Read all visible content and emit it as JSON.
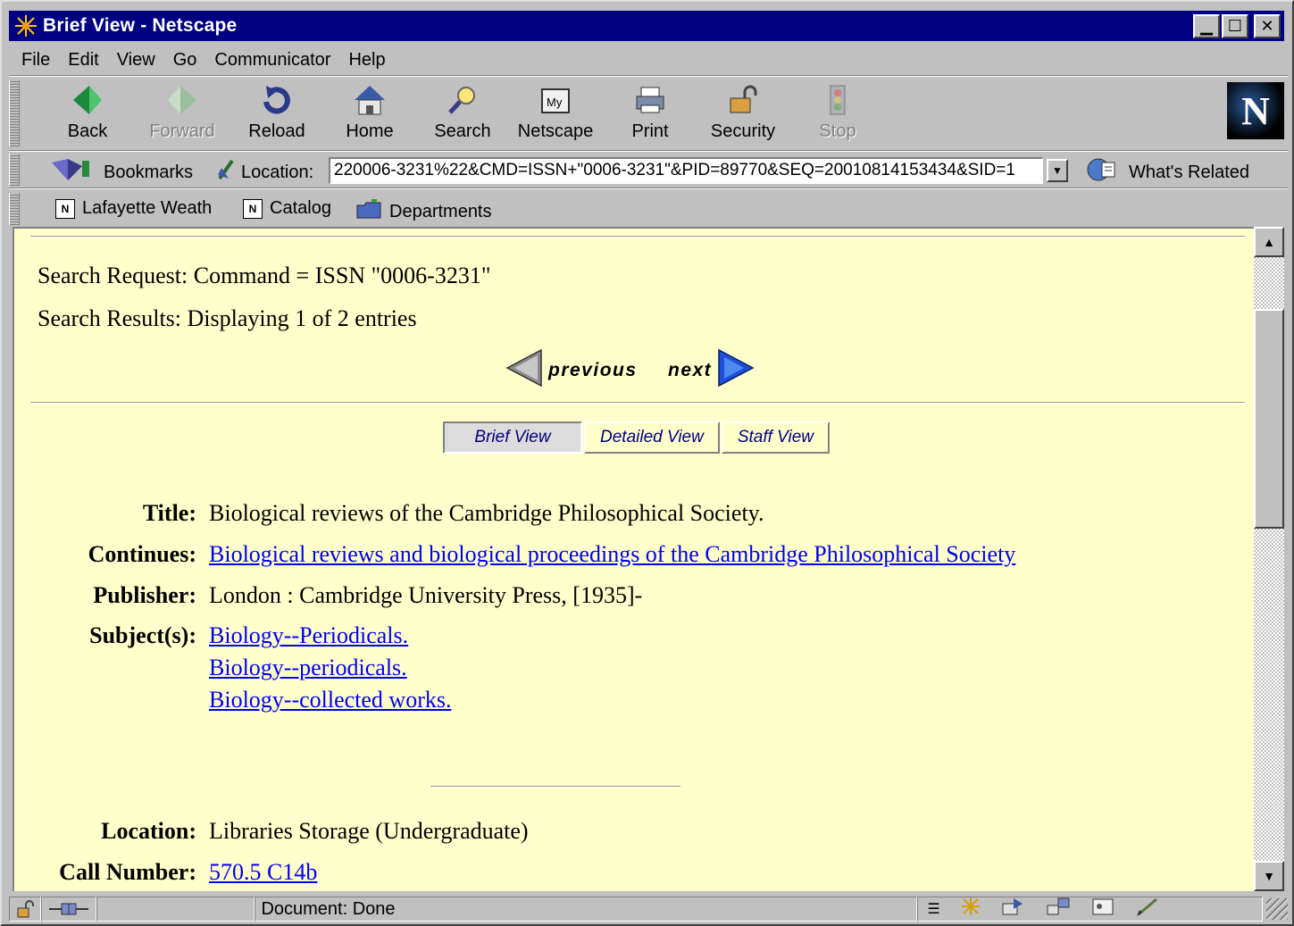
{
  "window": {
    "title": "Brief View - Netscape"
  },
  "menu": {
    "file": "File",
    "edit": "Edit",
    "view": "View",
    "go": "Go",
    "communicator": "Communicator",
    "help": "Help"
  },
  "toolbar": {
    "back": "Back",
    "forward": "Forward",
    "reload": "Reload",
    "home": "Home",
    "search": "Search",
    "netscape": "Netscape",
    "print": "Print",
    "security": "Security",
    "stop": "Stop"
  },
  "location_bar": {
    "bookmarks": "Bookmarks",
    "location_label": "Location:",
    "url": "220006-3231%22&CMD=ISSN+\"0006-3231\"&PID=89770&SEQ=20010814153434&SID=1",
    "whats_related": "What's Related"
  },
  "personal_toolbar": {
    "items": [
      "Lafayette Weath",
      "Catalog",
      "Departments"
    ]
  },
  "page": {
    "search_request": "Search Request: Command = ISSN \"0006-3231\"",
    "search_results": "Search Results: Displaying 1 of 2 entries",
    "previous": "previous",
    "next": "next",
    "tabs": {
      "brief": "Brief View",
      "detailed": "Detailed View",
      "staff": "Staff View"
    },
    "record": {
      "title_label": "Title:",
      "title_value": "Biological reviews of the Cambridge Philosophical Society.",
      "continues_label": "Continues:",
      "continues_value": "Biological reviews and biological proceedings of the Cambridge Philosophical Society",
      "publisher_label": "Publisher:",
      "publisher_value": "London : Cambridge University Press, [1935]-",
      "subjects_label": "Subject(s):",
      "subjects": [
        "Biology--Periodicals.",
        "Biology--periodicals.",
        "Biology--collected works."
      ],
      "location_label": "Location:",
      "location_value": "Libraries Storage (Undergraduate)",
      "callnumber_label": "Call Number:",
      "callnumber_value": "570.5 C14b"
    }
  },
  "status": {
    "text": "Document: Done"
  },
  "colors": {
    "titlebar": "#000080",
    "content_bg": "#ffffcc",
    "link": "#0000ee"
  }
}
